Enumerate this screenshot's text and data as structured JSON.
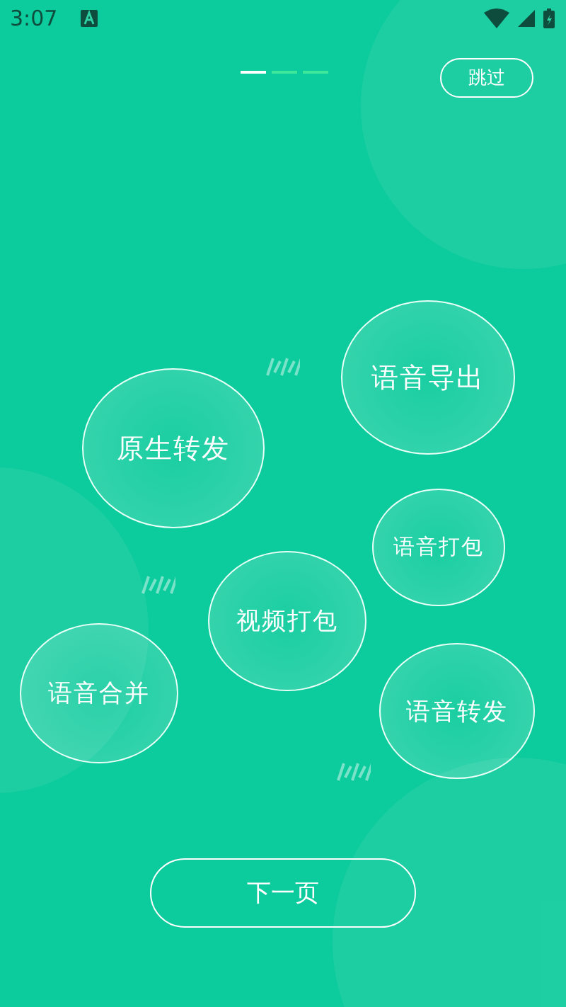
{
  "status_bar": {
    "time": "3:07"
  },
  "pager": [
    {
      "selected": true
    },
    {
      "selected": false
    },
    {
      "selected": false
    }
  ],
  "skip_button": "跳过",
  "bubbles": [
    {
      "label": "语音导出"
    },
    {
      "label": "原生转发"
    },
    {
      "label": "语音打包"
    },
    {
      "label": "视频打包"
    },
    {
      "label": "语音合并"
    },
    {
      "label": "语音转发"
    }
  ],
  "next_button": "下一页"
}
